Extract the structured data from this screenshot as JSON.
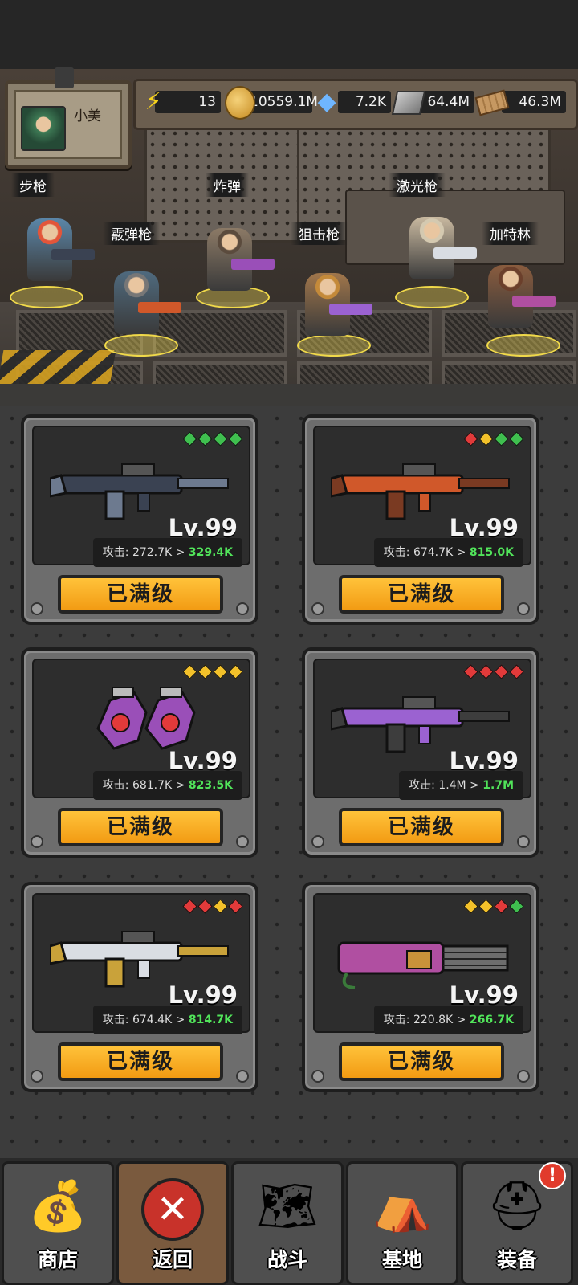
{
  "profile": {
    "name": "小美"
  },
  "resources": [
    {
      "name": "energy",
      "icon": "lightning-icon",
      "value": "13",
      "color": "#f7d21b"
    },
    {
      "name": "gold",
      "icon": "coin-icon",
      "value": "10559.1M",
      "color": "#d9a73a"
    },
    {
      "name": "crystal",
      "icon": "crystal-icon",
      "value": "7.2K",
      "color": "#6fb6ff"
    },
    {
      "name": "steel",
      "icon": "steel-icon",
      "value": "64.4M",
      "color": "#9a9a9a"
    },
    {
      "name": "wood",
      "icon": "wood-icon",
      "value": "46.3M",
      "color": "#b98b57"
    }
  ],
  "squad": [
    {
      "label": "步枪",
      "body_color": "#5b86a8",
      "hair": "#e2553a"
    },
    {
      "label": "霰弹枪",
      "body_color": "#4f6a7e",
      "hair": "#777"
    },
    {
      "label": "炸弹",
      "body_color": "#8c7a66",
      "hair": "#5b4b3d"
    },
    {
      "label": "狙击枪",
      "body_color": "#a0764b",
      "hair": "#c48a3a"
    },
    {
      "label": "激光枪",
      "body_color": "#c9b9a0",
      "hair": "#d4c9b0"
    },
    {
      "label": "加特林",
      "body_color": "#8a5c3e",
      "hair": "#6b3f2b"
    }
  ],
  "weapons": [
    {
      "name": "步枪",
      "level": "Lv.99",
      "atk_label": "攻击:",
      "atk_from": "272.7K",
      "atk_arrow": ">",
      "atk_to": "329.4K",
      "gems": [
        "#3fbf4f",
        "#3fbf4f",
        "#3fbf4f",
        "#3fbf4f"
      ],
      "color": "#3a4252",
      "accent": "#6d7a8f",
      "button": "已满级"
    },
    {
      "name": "霰弹枪",
      "level": "Lv.99",
      "atk_label": "攻击:",
      "atk_from": "674.7K",
      "atk_arrow": ">",
      "atk_to": "815.0K",
      "gems": [
        "#e23a3a",
        "#f3c12a",
        "#3fbf4f",
        "#3fbf4f"
      ],
      "color": "#d0582a",
      "accent": "#7a3a22",
      "button": "已满级"
    },
    {
      "name": "炸弹",
      "level": "Lv.99",
      "atk_label": "攻击:",
      "atk_from": "681.7K",
      "atk_arrow": ">",
      "atk_to": "823.5K",
      "gems": [
        "#f3c12a",
        "#f3c12a",
        "#f3c12a",
        "#f3c12a"
      ],
      "color": "#9a4fb8",
      "accent": "#e23a3a",
      "button": "已满级"
    },
    {
      "name": "狙击枪",
      "level": "Lv.99",
      "atk_label": "攻击:",
      "atk_from": "1.4M",
      "atk_arrow": ">",
      "atk_to": "1.7M",
      "gems": [
        "#e23a3a",
        "#e23a3a",
        "#e23a3a",
        "#e23a3a"
      ],
      "color": "#9b62d1",
      "accent": "#3d3d3d",
      "button": "已满级"
    },
    {
      "name": "激光枪",
      "level": "Lv.99",
      "atk_label": "攻击:",
      "atk_from": "674.4K",
      "atk_arrow": ">",
      "atk_to": "814.7K",
      "gems": [
        "#e23a3a",
        "#e23a3a",
        "#f3c12a",
        "#e23a3a"
      ],
      "color": "#d9dde3",
      "accent": "#c9a23a",
      "button": "已满级"
    },
    {
      "name": "加特林",
      "level": "Lv.99",
      "atk_label": "攻击:",
      "atk_from": "220.8K",
      "atk_arrow": ">",
      "atk_to": "266.7K",
      "gems": [
        "#f3c12a",
        "#f3c12a",
        "#e23a3a",
        "#3fbf4f"
      ],
      "color": "#b04fa1",
      "accent": "#6d6d6d",
      "button": "已满级"
    }
  ],
  "nav": [
    {
      "label": "商店",
      "icon": "money-bag-icon",
      "glyph": "💰"
    },
    {
      "label": "返回",
      "icon": "close-icon",
      "glyph": "✕"
    },
    {
      "label": "战斗",
      "icon": "map-icon",
      "glyph": "🗺"
    },
    {
      "label": "基地",
      "icon": "tent-icon",
      "glyph": "⛺"
    },
    {
      "label": "装备",
      "icon": "helmet-icon",
      "glyph": "⛑",
      "badge": "!"
    }
  ]
}
